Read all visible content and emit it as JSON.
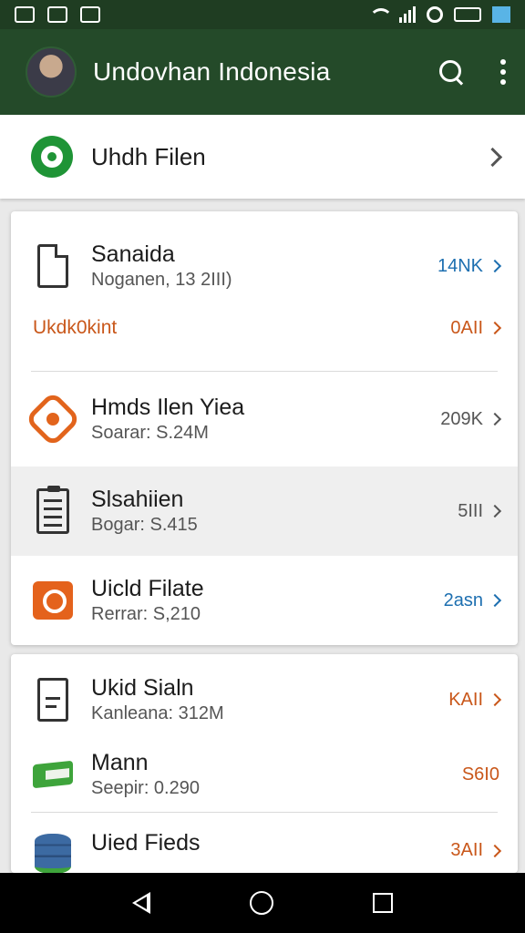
{
  "app": {
    "title": "Undovhan Indonesia"
  },
  "top_item": {
    "label": "Uhdh Filen"
  },
  "card1": {
    "section_label": "Ukdk0kint",
    "section_meta": "0AII",
    "rows": [
      {
        "title": "Sanaida",
        "subtitle": "Noganen, 13 2III)",
        "meta": "14NK",
        "icon": "document-icon"
      },
      {
        "title": "Hmds Ilen Yiea",
        "subtitle": "Soarar: S.24M",
        "meta": "209K",
        "icon": "hexagon-icon"
      },
      {
        "title": "Slsahiien",
        "subtitle": "Bogar: S.415",
        "meta": "5III",
        "icon": "clipboard-icon"
      },
      {
        "title": "Uicld Filate",
        "subtitle": "Rerrar: S,210",
        "meta": "2asn",
        "icon": "camera-icon"
      }
    ]
  },
  "card2": {
    "rows": [
      {
        "title": "Ukid Sialn",
        "subtitle": "Kanleana: 312M",
        "meta": "KAII",
        "icon": "note-icon"
      },
      {
        "title": "Mann",
        "subtitle": "Seepir: 0.290",
        "meta": "S6I0",
        "icon": "tag-icon"
      },
      {
        "title": "Uied Fieds",
        "subtitle": "",
        "meta": "3AII",
        "icon": "database-icon"
      }
    ]
  },
  "colors": {
    "statusbar": "#1f3d22",
    "appbar": "#244a29",
    "accent_green": "#1f9436",
    "meta_blue": "#1d6fb0",
    "meta_orange": "#c9571a",
    "meta_gray": "#555555"
  }
}
